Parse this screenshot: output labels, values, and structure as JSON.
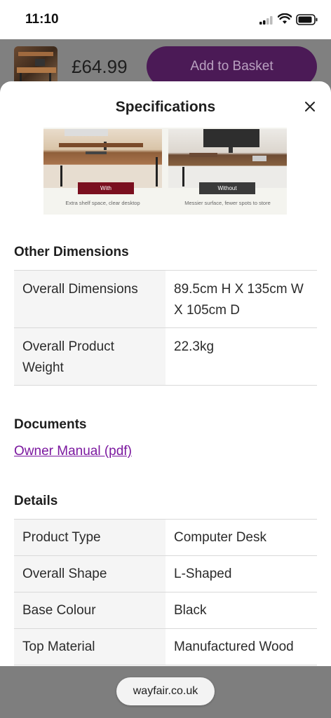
{
  "status": {
    "time": "11:10"
  },
  "product_bar": {
    "price": "£64.99",
    "add_to_basket": "Add to Basket"
  },
  "sheet": {
    "title": "Specifications",
    "promo": {
      "with_label": "With",
      "without_label": "Without",
      "with_caption": "Extra shelf space, clear desktop",
      "without_caption": "Messier surface, fewer spots to store"
    },
    "other_dimensions": {
      "title": "Other Dimensions",
      "rows": [
        {
          "key": "Overall Dimensions",
          "value": "89.5cm H X 135cm W X 105cm D"
        },
        {
          "key": "Overall Product Weight",
          "value": "22.3kg"
        }
      ]
    },
    "documents": {
      "title": "Documents",
      "link": "Owner Manual (pdf)"
    },
    "details": {
      "title": "Details",
      "rows": [
        {
          "key": "Product Type",
          "value": "Computer Desk"
        },
        {
          "key": "Overall Shape",
          "value": "L-Shaped"
        },
        {
          "key": "Base Colour",
          "value": "Black"
        },
        {
          "key": "Top Material",
          "value": "Manufactured Wood"
        }
      ]
    }
  },
  "browser": {
    "url": "wayfair.co.uk"
  }
}
